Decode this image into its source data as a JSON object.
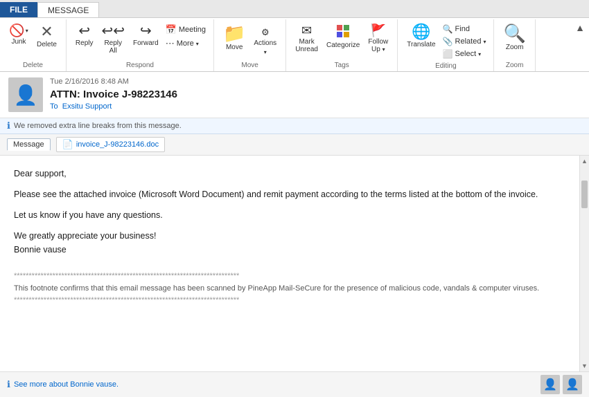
{
  "tabs": {
    "file_label": "FILE",
    "message_label": "MESSAGE"
  },
  "ribbon": {
    "groups": [
      {
        "name": "delete",
        "label": "Delete",
        "buttons": [
          {
            "id": "junk",
            "label": "Junk",
            "icon": "🚫",
            "has_dropdown": true
          },
          {
            "id": "delete",
            "label": "Delete",
            "icon": "✕",
            "large": true
          }
        ]
      },
      {
        "name": "respond",
        "label": "Respond",
        "buttons": [
          {
            "id": "reply",
            "label": "Reply",
            "icon": "↩"
          },
          {
            "id": "reply-all",
            "label": "Reply\nAll",
            "icon": "↩↩"
          },
          {
            "id": "forward",
            "label": "Forward",
            "icon": "↪"
          },
          {
            "id": "meeting",
            "label": "Meeting",
            "icon": "📅"
          },
          {
            "id": "more",
            "label": "More",
            "icon": "⋯",
            "has_dropdown": true
          }
        ]
      },
      {
        "name": "move",
        "label": "Move",
        "buttons": [
          {
            "id": "move",
            "label": "Move",
            "icon": "📁",
            "large": true
          },
          {
            "id": "actions",
            "label": "Actions",
            "icon": "⚙",
            "has_dropdown": true
          }
        ]
      },
      {
        "name": "tags",
        "label": "Tags",
        "buttons": [
          {
            "id": "mark-unread",
            "label": "Mark\nUnread",
            "icon": "✉"
          },
          {
            "id": "categorize",
            "label": "Categorize",
            "icon": "🏷"
          },
          {
            "id": "follow-up",
            "label": "Follow\nUp",
            "icon": "🚩",
            "has_dropdown": true
          }
        ]
      },
      {
        "name": "editing",
        "label": "Editing",
        "small_buttons": [
          {
            "id": "translate",
            "label": "Translate",
            "icon": "🌐",
            "has_dropdown": true
          },
          {
            "id": "find",
            "label": "Find",
            "icon": "🔍"
          },
          {
            "id": "related",
            "label": "Related",
            "icon": "📎",
            "has_dropdown": true
          },
          {
            "id": "select",
            "label": "Select",
            "icon": "⬜",
            "has_dropdown": true
          }
        ]
      },
      {
        "name": "zoom",
        "label": "Zoom",
        "buttons": [
          {
            "id": "zoom",
            "label": "Zoom",
            "icon": "🔍",
            "large": true
          }
        ]
      }
    ]
  },
  "email": {
    "datetime": "Tue 2/16/2016 8:48 AM",
    "subject": "ATTN: Invoice J-98223146",
    "to_label": "To",
    "to_value": "Exsitu Support",
    "info_message": "We removed extra line breaks from this message.",
    "attachment_tab_label": "Message",
    "attachment_file_label": "invoice_J-98223146.doc",
    "body": {
      "greeting": "Dear support,",
      "paragraph1": "Please see the attached invoice (Microsoft Word Document) and remit payment according to the terms listed at the bottom of the invoice.",
      "paragraph2": "Let us know if you have any questions.",
      "paragraph3": "We greatly appreciate your business!\nBonnie vause",
      "footnote_stars1": "****************************************************************************",
      "footnote_text": "This footnote confirms that this email message has been scanned by PineApp Mail-SeCure for the presence of malicious code, vandals & computer viruses.",
      "footnote_stars2": "****************************************************************************"
    }
  },
  "bottom_bar": {
    "info_text": "See more about Bonnie vause."
  }
}
